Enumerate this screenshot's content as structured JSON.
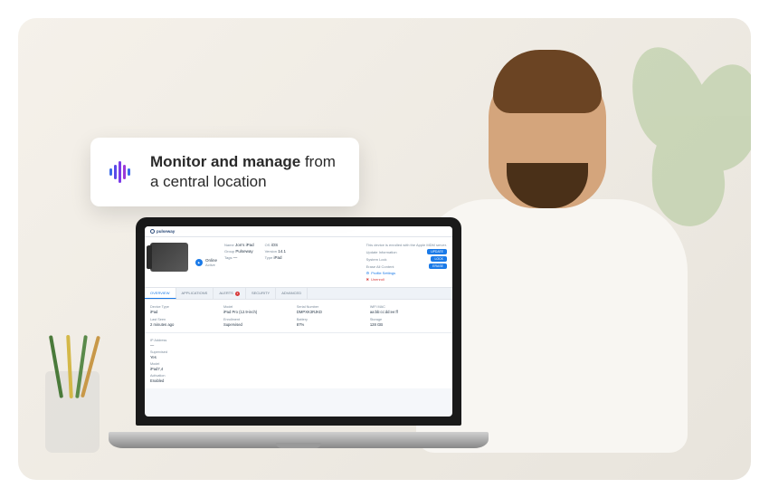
{
  "callout": {
    "line1_bold": "Monitor and manage",
    "line1_rest": " from",
    "line2": "a central location"
  },
  "dashboard": {
    "brand": "pulseway",
    "device": {
      "status_label": "Online",
      "status_sub": "Active"
    },
    "info_cols": [
      {
        "rows": [
          {
            "label": "Name",
            "value": "Jon's iPad"
          },
          {
            "label": "Group",
            "value": "Pulseway"
          },
          {
            "label": "Tags",
            "value": "—"
          }
        ]
      },
      {
        "rows": [
          {
            "label": "OS",
            "value": "iOS"
          },
          {
            "label": "Version",
            "value": "14.1"
          },
          {
            "label": "Type",
            "value": "iPad"
          }
        ]
      }
    ],
    "action_panel": {
      "note": "This device is enrolled with the Apple MDM server.",
      "rows": [
        {
          "label": "Update Information",
          "button": "UPDATE"
        },
        {
          "label": "System Lock",
          "button": "LOCK"
        },
        {
          "label": "Erase All Content",
          "button": "ERASE"
        }
      ],
      "links": [
        {
          "label": "Profile Settings",
          "kind": "normal"
        },
        {
          "label": "Unenroll",
          "kind": "danger"
        }
      ]
    },
    "tabs": [
      {
        "label": "OVERVIEW",
        "active": true
      },
      {
        "label": "APPLICATIONS"
      },
      {
        "label": "ALERTS",
        "badge": "1"
      },
      {
        "label": "SECURITY"
      },
      {
        "label": "ADVANCED"
      }
    ],
    "details": [
      {
        "label": "Device Type",
        "value": "iPad"
      },
      {
        "label": "Model",
        "value": "iPad Pro (12.9-inch)"
      },
      {
        "label": "Serial Number",
        "value": "DMPXK3RJKD"
      },
      {
        "label": "WiFi MAC",
        "value": "aa:bb:cc:dd:ee:ff"
      },
      {
        "label": "Last Seen",
        "value": "2 minutes ago"
      },
      {
        "label": "Enrollment",
        "value": "Supervised"
      },
      {
        "label": "Battery",
        "value": "87%"
      },
      {
        "label": "Storage",
        "value": "128 GB"
      }
    ],
    "lower": [
      {
        "label": "IP Address",
        "value": "—"
      },
      {
        "label": "Supervised",
        "value": "Yes"
      },
      {
        "label": "Model",
        "value": "iPad7,4"
      },
      {
        "label": "Activation",
        "value": "Enabled"
      }
    ]
  }
}
